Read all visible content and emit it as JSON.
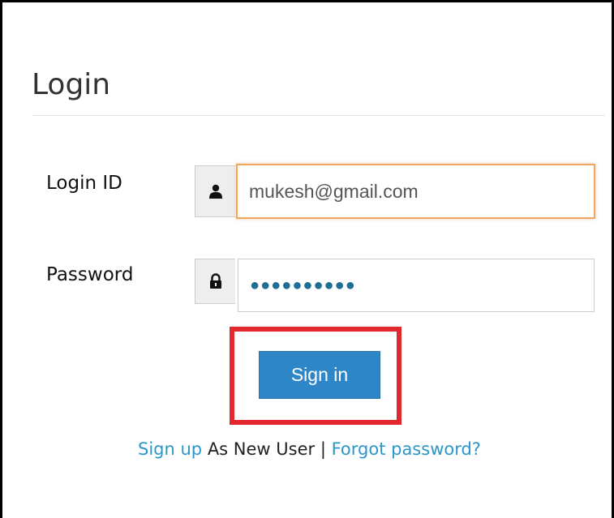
{
  "login": {
    "title": "Login"
  },
  "form": {
    "login_id_label": "Login ID",
    "login_id_value": "mukesh@gmail.com",
    "password_label": "Password",
    "password_value": "●●●●●●●●●●",
    "user_icon": "user-icon",
    "lock_icon": "lock-icon",
    "sign_in_label": "Sign in"
  },
  "footer": {
    "signup_link": "Sign up",
    "as_new_user": " As New User | ",
    "forgot_link": "Forgot password?"
  },
  "colors": {
    "accent": "#2f86c7",
    "link": "#2b97c9",
    "highlight": "#e1282c",
    "focus_border": "#f0a65d"
  }
}
